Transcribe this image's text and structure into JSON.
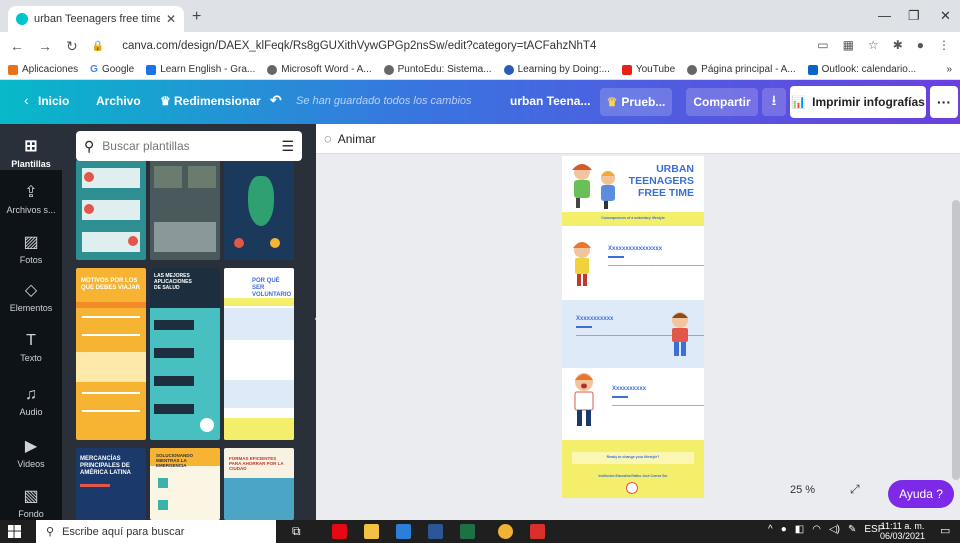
{
  "browser": {
    "tab_title": "urban Teenagers free time - Info",
    "url": "canva.com/design/DAEX_klFeqk/Rs8gGUXithVywGPGp2nsSw/edit?category=tACFahzNhT4",
    "bookmarks": [
      "Aplicaciones",
      "Google",
      "Learn English - Gra...",
      "Microsoft Word - A...",
      "PuntoEdu: Sistema...",
      "Learning by Doing:...",
      "YouTube",
      "Página principal - A...",
      "Outlook: calendario..."
    ]
  },
  "toolbar": {
    "inicio": "Inicio",
    "archivo": "Archivo",
    "redimensionar": "Redimensionar",
    "saved": "Se han guardado todos los cambios",
    "design_name": "urban Teena...",
    "prueba": "Prueb...",
    "compartir": "Compartir",
    "imprimir": "Imprimir infografías"
  },
  "rail": [
    "Plantillas",
    "Archivos s...",
    "Fotos",
    "Elementos",
    "Texto",
    "Audio",
    "Videos",
    "Fondo"
  ],
  "panel": {
    "search_placeholder": "Buscar plantillas",
    "t_motivos": "MOTIVOS POR LOS QUE DEBES VIAJAR",
    "t_aplicaciones": "LAS MEJORES APLICACIONES DE SALUD",
    "t_voluntario": "POR QUÉ SER VOLUNTARIO",
    "t_mercancias": "MERCANCÍAS PRINCIPALES DE AMÉRICA LATINA",
    "t_solucionando": "SOLUCIONANDO MIENTRAS LA EMERGENCIA",
    "t_formas": "FORMAS EFICIENTES PARA AHORRAR POR LA CIUDAD"
  },
  "workspace": {
    "animar": "Animar",
    "zoom": "25 %",
    "ayuda": "Ayuda ?"
  },
  "infographic": {
    "title_lines": [
      "URBAN",
      "TEENAGERS",
      "FREE TIME"
    ],
    "subtitle": "Consequences of a sedentary lifestyle",
    "heading": "Xxxxxxxxxxxxxxxx",
    "heading2": "Xxxxxxxxxxx",
    "heading3": "Xxxxxxxxxx",
    "ready": "Ready to change your lifestyle?",
    "school": "Institución Educativa Rafino José Cuervo Sur"
  },
  "taskbar": {
    "search": "Escribe aquí para buscar",
    "lang": "ESP",
    "time": "11:11 a. m.",
    "date": "06/03/2021"
  },
  "colors": {
    "accent": "#7d2ae8",
    "infographic_blue": "#3b6fd8",
    "yellow": "#f4ef6a",
    "panel": "#293039"
  }
}
